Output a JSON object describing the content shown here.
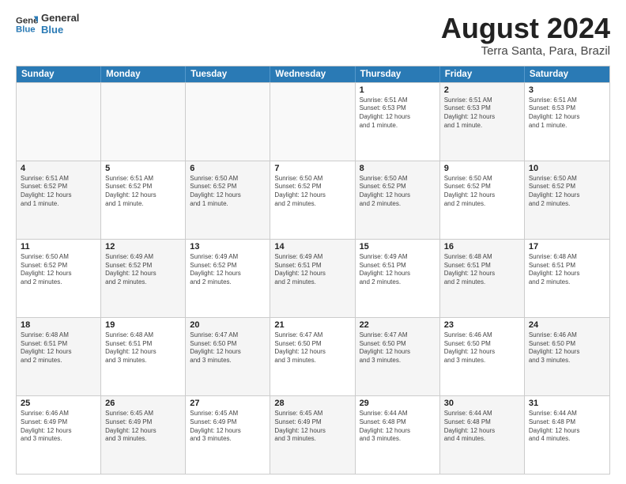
{
  "logo": {
    "line1": "General",
    "line2": "Blue"
  },
  "title": "August 2024",
  "subtitle": "Terra Santa, Para, Brazil",
  "days_of_week": [
    "Sunday",
    "Monday",
    "Tuesday",
    "Wednesday",
    "Thursday",
    "Friday",
    "Saturday"
  ],
  "weeks": [
    [
      {
        "day": "",
        "info": "",
        "empty": true
      },
      {
        "day": "",
        "info": "",
        "empty": true
      },
      {
        "day": "",
        "info": "",
        "empty": true
      },
      {
        "day": "",
        "info": "",
        "empty": true
      },
      {
        "day": "1",
        "info": "Sunrise: 6:51 AM\nSunset: 6:53 PM\nDaylight: 12 hours\nand 1 minute.",
        "shaded": false
      },
      {
        "day": "2",
        "info": "Sunrise: 6:51 AM\nSunset: 6:53 PM\nDaylight: 12 hours\nand 1 minute.",
        "shaded": true
      },
      {
        "day": "3",
        "info": "Sunrise: 6:51 AM\nSunset: 6:53 PM\nDaylight: 12 hours\nand 1 minute.",
        "shaded": false
      }
    ],
    [
      {
        "day": "4",
        "info": "Sunrise: 6:51 AM\nSunset: 6:52 PM\nDaylight: 12 hours\nand 1 minute.",
        "shaded": true
      },
      {
        "day": "5",
        "info": "Sunrise: 6:51 AM\nSunset: 6:52 PM\nDaylight: 12 hours\nand 1 minute.",
        "shaded": false
      },
      {
        "day": "6",
        "info": "Sunrise: 6:50 AM\nSunset: 6:52 PM\nDaylight: 12 hours\nand 1 minute.",
        "shaded": true
      },
      {
        "day": "7",
        "info": "Sunrise: 6:50 AM\nSunset: 6:52 PM\nDaylight: 12 hours\nand 2 minutes.",
        "shaded": false
      },
      {
        "day": "8",
        "info": "Sunrise: 6:50 AM\nSunset: 6:52 PM\nDaylight: 12 hours\nand 2 minutes.",
        "shaded": true
      },
      {
        "day": "9",
        "info": "Sunrise: 6:50 AM\nSunset: 6:52 PM\nDaylight: 12 hours\nand 2 minutes.",
        "shaded": false
      },
      {
        "day": "10",
        "info": "Sunrise: 6:50 AM\nSunset: 6:52 PM\nDaylight: 12 hours\nand 2 minutes.",
        "shaded": true
      }
    ],
    [
      {
        "day": "11",
        "info": "Sunrise: 6:50 AM\nSunset: 6:52 PM\nDaylight: 12 hours\nand 2 minutes.",
        "shaded": false
      },
      {
        "day": "12",
        "info": "Sunrise: 6:49 AM\nSunset: 6:52 PM\nDaylight: 12 hours\nand 2 minutes.",
        "shaded": true
      },
      {
        "day": "13",
        "info": "Sunrise: 6:49 AM\nSunset: 6:52 PM\nDaylight: 12 hours\nand 2 minutes.",
        "shaded": false
      },
      {
        "day": "14",
        "info": "Sunrise: 6:49 AM\nSunset: 6:51 PM\nDaylight: 12 hours\nand 2 minutes.",
        "shaded": true
      },
      {
        "day": "15",
        "info": "Sunrise: 6:49 AM\nSunset: 6:51 PM\nDaylight: 12 hours\nand 2 minutes.",
        "shaded": false
      },
      {
        "day": "16",
        "info": "Sunrise: 6:48 AM\nSunset: 6:51 PM\nDaylight: 12 hours\nand 2 minutes.",
        "shaded": true
      },
      {
        "day": "17",
        "info": "Sunrise: 6:48 AM\nSunset: 6:51 PM\nDaylight: 12 hours\nand 2 minutes.",
        "shaded": false
      }
    ],
    [
      {
        "day": "18",
        "info": "Sunrise: 6:48 AM\nSunset: 6:51 PM\nDaylight: 12 hours\nand 2 minutes.",
        "shaded": true
      },
      {
        "day": "19",
        "info": "Sunrise: 6:48 AM\nSunset: 6:51 PM\nDaylight: 12 hours\nand 3 minutes.",
        "shaded": false
      },
      {
        "day": "20",
        "info": "Sunrise: 6:47 AM\nSunset: 6:50 PM\nDaylight: 12 hours\nand 3 minutes.",
        "shaded": true
      },
      {
        "day": "21",
        "info": "Sunrise: 6:47 AM\nSunset: 6:50 PM\nDaylight: 12 hours\nand 3 minutes.",
        "shaded": false
      },
      {
        "day": "22",
        "info": "Sunrise: 6:47 AM\nSunset: 6:50 PM\nDaylight: 12 hours\nand 3 minutes.",
        "shaded": true
      },
      {
        "day": "23",
        "info": "Sunrise: 6:46 AM\nSunset: 6:50 PM\nDaylight: 12 hours\nand 3 minutes.",
        "shaded": false
      },
      {
        "day": "24",
        "info": "Sunrise: 6:46 AM\nSunset: 6:50 PM\nDaylight: 12 hours\nand 3 minutes.",
        "shaded": true
      }
    ],
    [
      {
        "day": "25",
        "info": "Sunrise: 6:46 AM\nSunset: 6:49 PM\nDaylight: 12 hours\nand 3 minutes.",
        "shaded": false
      },
      {
        "day": "26",
        "info": "Sunrise: 6:45 AM\nSunset: 6:49 PM\nDaylight: 12 hours\nand 3 minutes.",
        "shaded": true
      },
      {
        "day": "27",
        "info": "Sunrise: 6:45 AM\nSunset: 6:49 PM\nDaylight: 12 hours\nand 3 minutes.",
        "shaded": false
      },
      {
        "day": "28",
        "info": "Sunrise: 6:45 AM\nSunset: 6:49 PM\nDaylight: 12 hours\nand 3 minutes.",
        "shaded": true
      },
      {
        "day": "29",
        "info": "Sunrise: 6:44 AM\nSunset: 6:48 PM\nDaylight: 12 hours\nand 3 minutes.",
        "shaded": false
      },
      {
        "day": "30",
        "info": "Sunrise: 6:44 AM\nSunset: 6:48 PM\nDaylight: 12 hours\nand 4 minutes.",
        "shaded": true
      },
      {
        "day": "31",
        "info": "Sunrise: 6:44 AM\nSunset: 6:48 PM\nDaylight: 12 hours\nand 4 minutes.",
        "shaded": false
      }
    ]
  ]
}
